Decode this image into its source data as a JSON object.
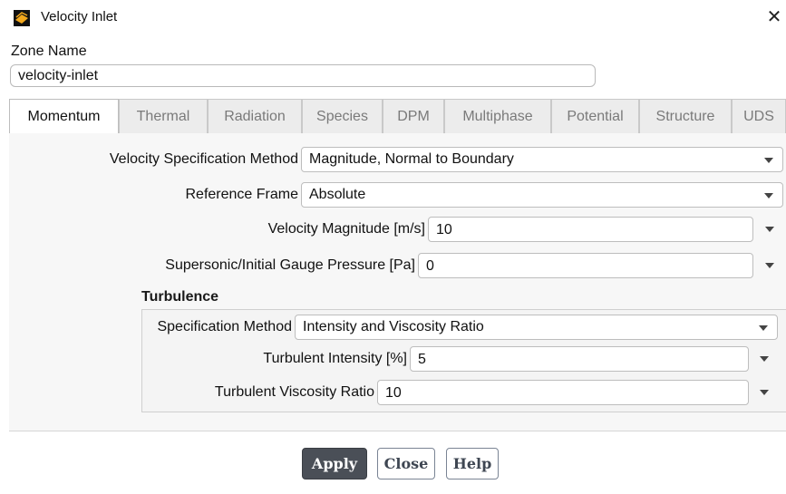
{
  "window": {
    "title": "Velocity Inlet",
    "close_glyph": "✕",
    "icon": "ansys-fluent-icon"
  },
  "zone": {
    "label": "Zone Name",
    "value": "velocity-inlet"
  },
  "tabs": [
    {
      "label": "Momentum",
      "active": true
    },
    {
      "label": "Thermal",
      "active": false
    },
    {
      "label": "Radiation",
      "active": false
    },
    {
      "label": "Species",
      "active": false
    },
    {
      "label": "DPM",
      "active": false
    },
    {
      "label": "Multiphase",
      "active": false
    },
    {
      "label": "Potential",
      "active": false
    },
    {
      "label": "Structure",
      "active": false
    },
    {
      "label": "UDS",
      "active": false
    }
  ],
  "momentum": {
    "velocity_spec_method": {
      "label": "Velocity Specification Method",
      "value": "Magnitude, Normal to Boundary"
    },
    "reference_frame": {
      "label": "Reference Frame",
      "value": "Absolute"
    },
    "velocity_magnitude": {
      "label": "Velocity Magnitude [m/s]",
      "value": "10"
    },
    "gauge_pressure": {
      "label": "Supersonic/Initial Gauge Pressure [Pa]",
      "value": "0"
    }
  },
  "turbulence": {
    "title": "Turbulence",
    "spec_method": {
      "label": "Specification Method",
      "value": "Intensity and Viscosity Ratio"
    },
    "intensity": {
      "label": "Turbulent Intensity [%]",
      "value": "5"
    },
    "viscosity_ratio": {
      "label": "Turbulent Viscosity Ratio",
      "value": "10"
    }
  },
  "buttons": {
    "apply": "Apply",
    "close": "Close",
    "help": "Help"
  },
  "colors": {
    "apply_bg": "#4a4f57",
    "icon_orange": "#f2a81d"
  }
}
